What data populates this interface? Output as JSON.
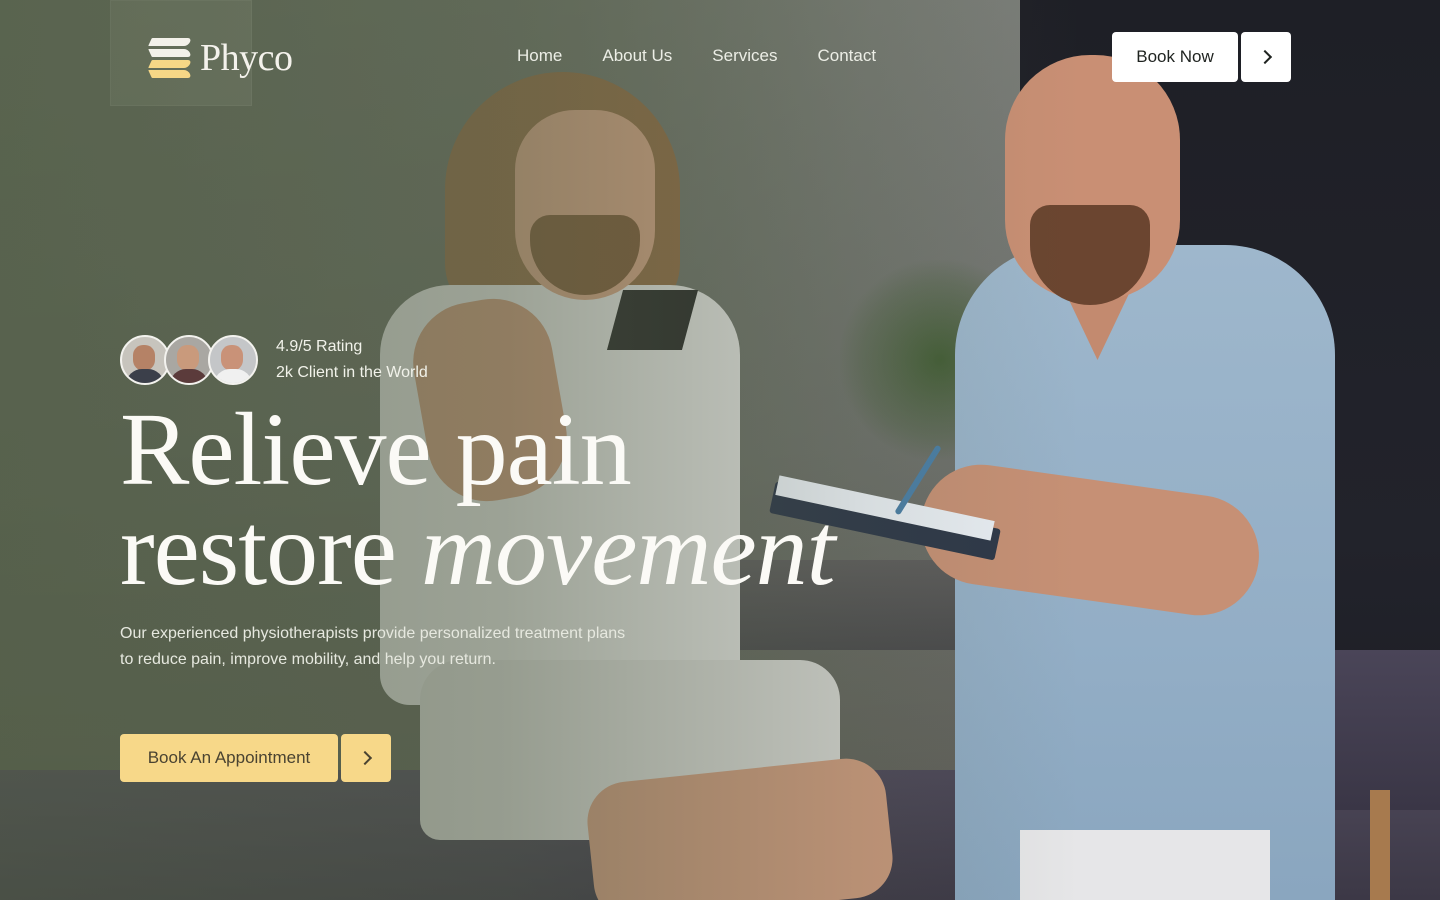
{
  "brand": {
    "name": "Phyco",
    "logo_icon": "layered-stripes-logo-icon",
    "colors": {
      "accent": "#f7d889",
      "light": "#ffffff",
      "text_light": "#f4f2ec"
    }
  },
  "nav": {
    "items": [
      {
        "label": "Home"
      },
      {
        "label": "About Us"
      },
      {
        "label": "Services"
      },
      {
        "label": "Contact"
      }
    ]
  },
  "header_cta": {
    "label": "Book Now",
    "arrow_icon": "chevron-right-icon"
  },
  "hero": {
    "rating_line": "4.9/5 Rating",
    "clients_line": "2k Client in the World",
    "headline_line1": "Relieve pain",
    "headline_line2_plain": "restore",
    "headline_line2_italic": "movement",
    "subcopy_line1": "Our experienced physiotherapists provide personalized treatment plans",
    "subcopy_line2": "to reduce pain, improve mobility, and help you return.",
    "cta_label": "Book An Appointment",
    "cta_arrow_icon": "chevron-right-icon"
  }
}
